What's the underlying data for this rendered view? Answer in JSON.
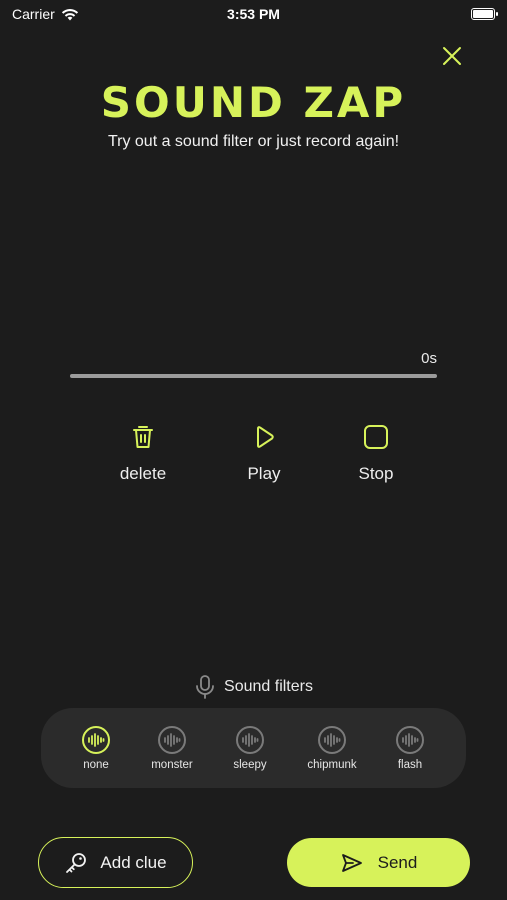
{
  "status_bar": {
    "carrier": "Carrier",
    "time": "3:53 PM"
  },
  "header": {
    "title": "SOUND ZAP",
    "subtitle": "Try out a sound filter or just record again!"
  },
  "player": {
    "duration": "0s",
    "progress": 0
  },
  "controls": {
    "delete_label": "delete",
    "play_label": "Play",
    "stop_label": "Stop"
  },
  "filters": {
    "header": "Sound filters",
    "items": [
      {
        "label": "none",
        "active": true
      },
      {
        "label": "monster",
        "active": false
      },
      {
        "label": "sleepy",
        "active": false
      },
      {
        "label": "chipmunk",
        "active": false
      },
      {
        "label": "flash",
        "active": false
      }
    ]
  },
  "actions": {
    "add_clue_label": "Add clue",
    "send_label": "Send"
  },
  "colors": {
    "accent": "#d7f25a",
    "background": "#1c1c1c",
    "panel": "#2b2b2b"
  }
}
